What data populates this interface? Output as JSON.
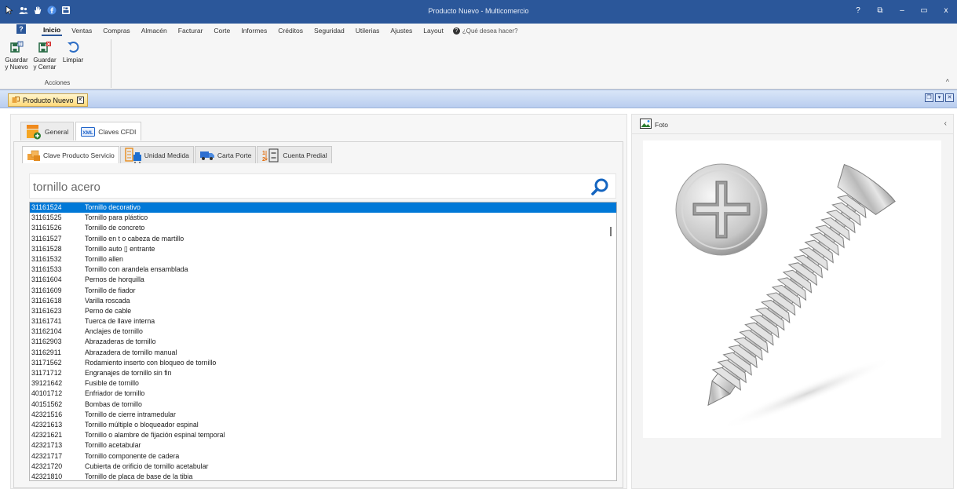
{
  "window": {
    "title": "Producto Nuevo - Multicomercio",
    "controls": [
      "?",
      "⧉",
      "–",
      "▭",
      "x"
    ]
  },
  "ribbon": {
    "tabs": [
      "Inicio",
      "Ventas",
      "Compras",
      "Almacén",
      "Facturar",
      "Corte",
      "Informes",
      "Créditos",
      "Seguridad",
      "Utilerias",
      "Ajustes",
      "Layout"
    ],
    "active_tab": "Inicio",
    "tell_me": "¿Qué desea hacer?",
    "group_label": "Acciones",
    "buttons": {
      "save_new": [
        "Guardar",
        "y Nuevo"
      ],
      "save_close": [
        "Guardar",
        "y Cerrar"
      ],
      "clear": [
        "Limpiar"
      ]
    },
    "collapse": "^"
  },
  "document_tab": {
    "label": "Producto Nuevo"
  },
  "main_tabs": [
    "General",
    "Claves CFDI"
  ],
  "main_tabs_icons": {
    "xml_badge": "XML"
  },
  "sub_tabs": [
    "Clave Producto Servicio",
    "Unidad Medida",
    "Carta Porte",
    "Cuenta Predial"
  ],
  "search": {
    "value": "tornillo acero"
  },
  "results": [
    {
      "code": "31161524",
      "name": "Tornillo decorativo"
    },
    {
      "code": "31161525",
      "name": "Tornillo para plástico"
    },
    {
      "code": "31161526",
      "name": "Tornillo de concreto"
    },
    {
      "code": "31161527",
      "name": "Tornillo en t o cabeza de martillo"
    },
    {
      "code": "31161528",
      "name": "Tornillo auto ▯ entrante"
    },
    {
      "code": "31161532",
      "name": "Tornillo allen"
    },
    {
      "code": "31161533",
      "name": "Tornillo con arandela ensamblada"
    },
    {
      "code": "31161604",
      "name": "Pernos de horquilla"
    },
    {
      "code": "31161609",
      "name": "Tornillo de fiador"
    },
    {
      "code": "31161618",
      "name": "Varilla roscada"
    },
    {
      "code": "31161623",
      "name": "Perno de cable"
    },
    {
      "code": "31161741",
      "name": "Tuerca de llave interna"
    },
    {
      "code": "31162104",
      "name": "Anclajes de tornillo"
    },
    {
      "code": "31162903",
      "name": "Abrazaderas de tornillo"
    },
    {
      "code": "31162911",
      "name": "Abrazadera de tornillo manual"
    },
    {
      "code": "31171562",
      "name": "Rodamiento inserto con bloqueo de tornillo"
    },
    {
      "code": "31171712",
      "name": "Engranajes de tornillo sin fin"
    },
    {
      "code": "39121642",
      "name": "Fusible de tornillo"
    },
    {
      "code": "40101712",
      "name": "Enfriador de tornillo"
    },
    {
      "code": "40151562",
      "name": "Bombas de tornillo"
    },
    {
      "code": "42321516",
      "name": "Tornillo de cierre intramedular"
    },
    {
      "code": "42321613",
      "name": "Tornillo múltiple o bloqueador espinal"
    },
    {
      "code": "42321621",
      "name": "Tornillo o alambre de fijación espinal temporal"
    },
    {
      "code": "42321713",
      "name": "Tornillo acetabular"
    },
    {
      "code": "42321717",
      "name": "Tornillo componente de cadera"
    },
    {
      "code": "42321720",
      "name": "Cubierta de orificio de tornillo acetabular"
    },
    {
      "code": "42321810",
      "name": "Tornillo de placa de base de la tibia"
    }
  ],
  "selected_index": 0,
  "photo_panel": {
    "label": "Foto"
  },
  "colors": {
    "titlebar": "#2b579a",
    "selection": "#0078d7",
    "search_icon": "#1565c0"
  }
}
